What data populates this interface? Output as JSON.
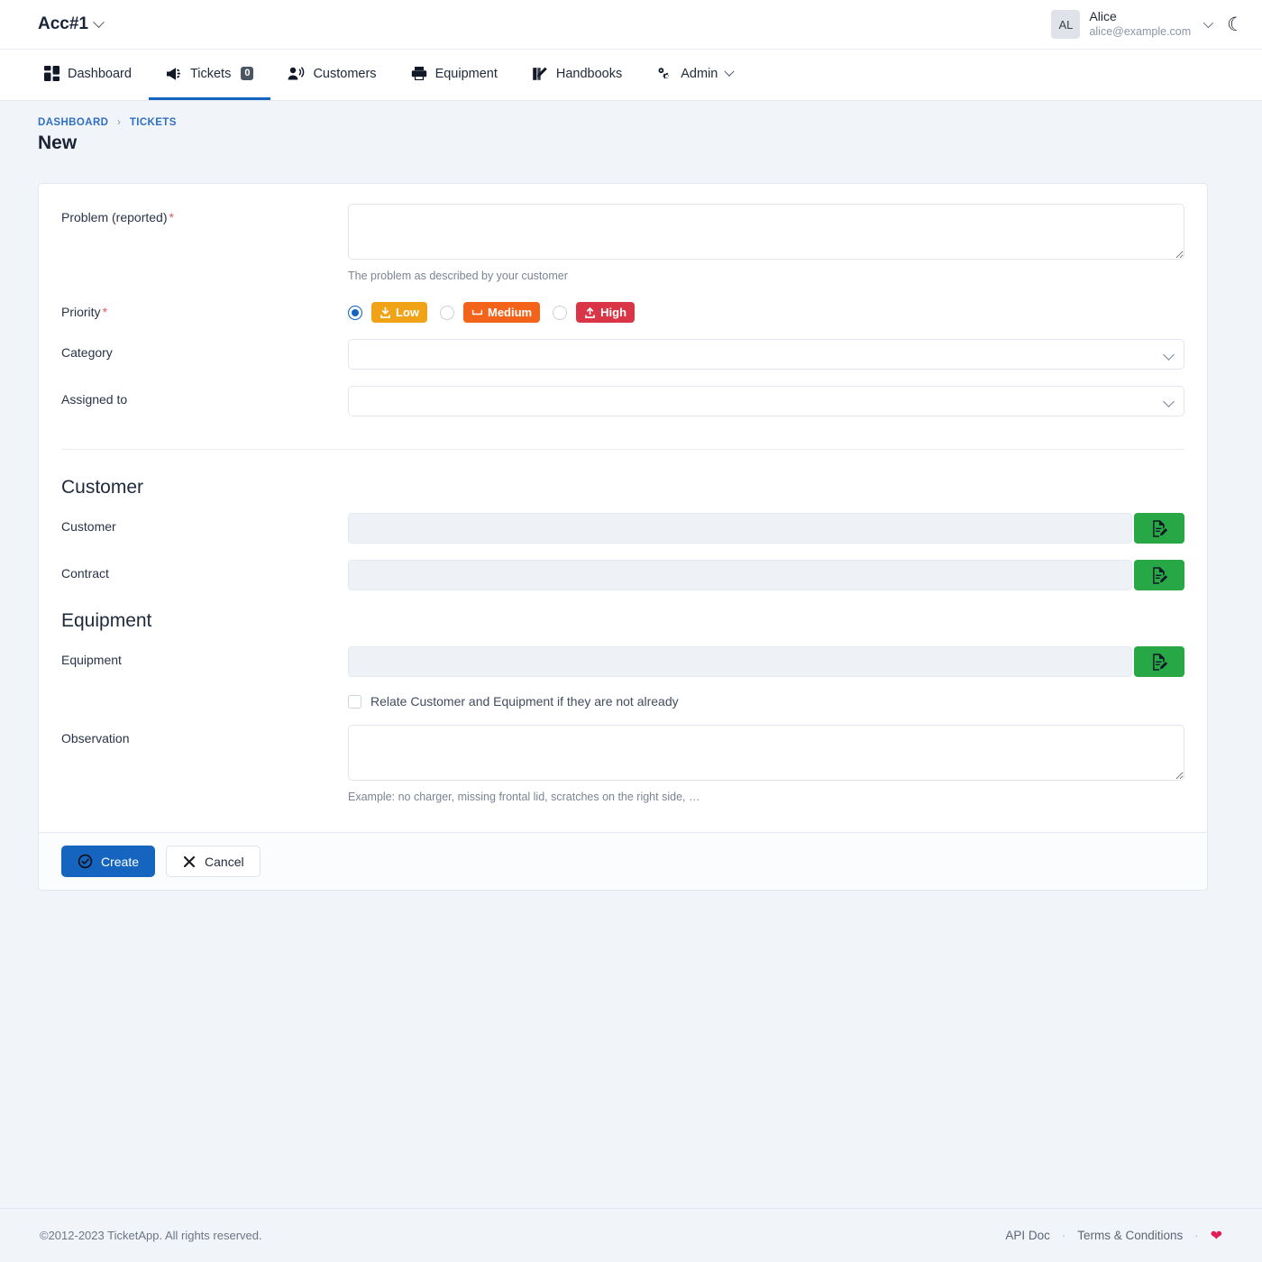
{
  "topbar": {
    "account": "Acc#1",
    "user": {
      "initials": "AL",
      "name": "Alice",
      "email": "alice@example.com"
    },
    "theme_toggle_icon": "moon-icon"
  },
  "nav": {
    "items": [
      {
        "label": "Dashboard",
        "icon": "dashboard-grid-icon",
        "active": false
      },
      {
        "label": "Tickets",
        "icon": "megaphone-icon",
        "active": true,
        "count": "0"
      },
      {
        "label": "Customers",
        "icon": "user-voice-icon",
        "active": false
      },
      {
        "label": "Equipment",
        "icon": "printer-icon",
        "active": false
      },
      {
        "label": "Handbooks",
        "icon": "handbook-pen-icon",
        "active": false
      },
      {
        "label": "Admin",
        "icon": "gears-icon",
        "active": false,
        "caret": true
      }
    ]
  },
  "breadcrumb": {
    "items": [
      "DASHBOARD",
      "TICKETS"
    ],
    "separator": "›"
  },
  "page_title": "New",
  "form": {
    "problem": {
      "label": "Problem (reported)",
      "required": "*",
      "value": "",
      "hint": "The problem as described by your customer"
    },
    "priority": {
      "label": "Priority",
      "required": "*",
      "selected": "Low",
      "options": [
        {
          "label": "Low",
          "icon": "arrow-down-tray-icon",
          "color": "#f0a317",
          "selected": true
        },
        {
          "label": "Medium",
          "icon": "tray-icon",
          "color": "#f3641a",
          "selected": false
        },
        {
          "label": "High",
          "icon": "arrow-up-tray-icon",
          "color": "#d93546",
          "selected": false
        }
      ]
    },
    "category": {
      "label": "Category",
      "value": ""
    },
    "assigned_to": {
      "label": "Assigned to",
      "value": ""
    },
    "customer_section": {
      "title": "Customer",
      "customer": {
        "label": "Customer",
        "value": "",
        "picker_icon": "file-edit-icon"
      },
      "contract": {
        "label": "Contract",
        "value": "",
        "picker_icon": "file-edit-icon"
      }
    },
    "equipment_section": {
      "title": "Equipment",
      "equipment": {
        "label": "Equipment",
        "value": "",
        "picker_icon": "file-edit-icon"
      },
      "relate_checkbox": {
        "label": "Relate Customer and Equipment if they are not already",
        "checked": false
      },
      "observation": {
        "label": "Observation",
        "value": "",
        "hint": "Example: no charger, missing frontal lid, scratches on the right side, …"
      }
    },
    "actions": {
      "create": {
        "label": "Create",
        "icon": "check-circle-icon"
      },
      "cancel": {
        "label": "Cancel",
        "icon": "close-x-icon"
      }
    }
  },
  "footer": {
    "copyright": "©2012-2023 TicketApp. All rights reserved.",
    "links": [
      "API Doc",
      "Terms & Conditions"
    ],
    "separator": "·",
    "heart_icon": "heart-icon"
  },
  "colors": {
    "accent": "#1565c0",
    "green": "#27a745",
    "heart": "#e01f5a",
    "required": "#e7565c"
  }
}
